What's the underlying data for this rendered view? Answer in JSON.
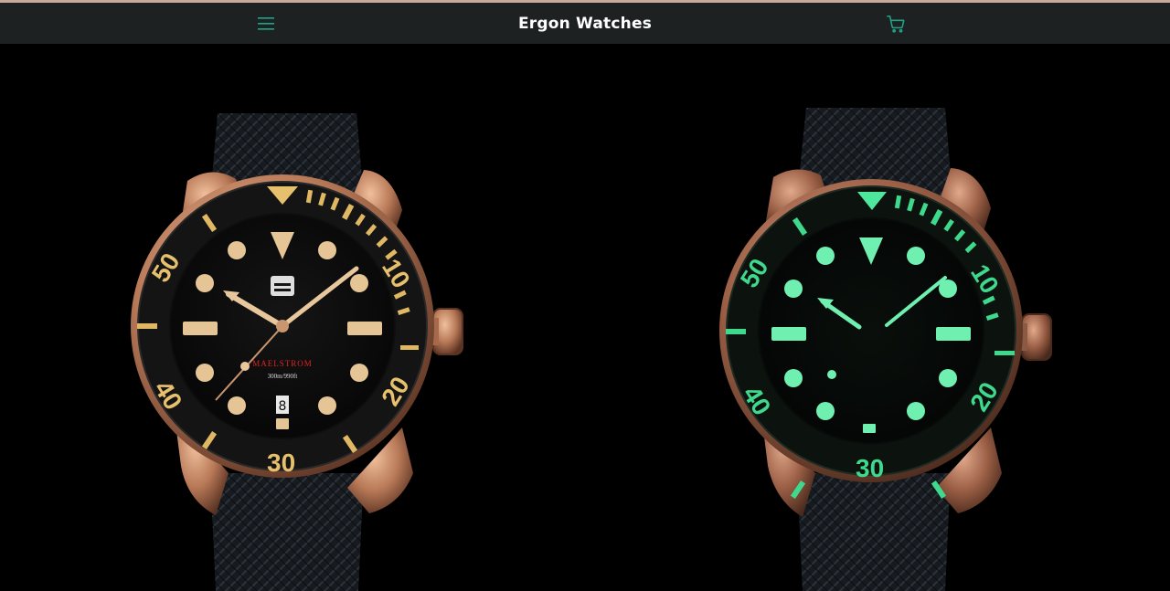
{
  "header": {
    "brand": "Ergon Watches",
    "menu_icon": "hamburger-menu-icon",
    "cart_icon": "shopping-cart-icon",
    "accent_color": "#1fa48a",
    "background_color": "#1d2121"
  },
  "hero": {
    "watch_left": {
      "dial_brand_text": "MAELSTROM",
      "depth_rating": "300m/990ft",
      "date_window": "8",
      "bezel_numbers": [
        "10",
        "20",
        "30",
        "40",
        "50"
      ]
    },
    "watch_right": {
      "bezel_numbers": [
        "10",
        "20",
        "30",
        "40",
        "50"
      ]
    }
  }
}
